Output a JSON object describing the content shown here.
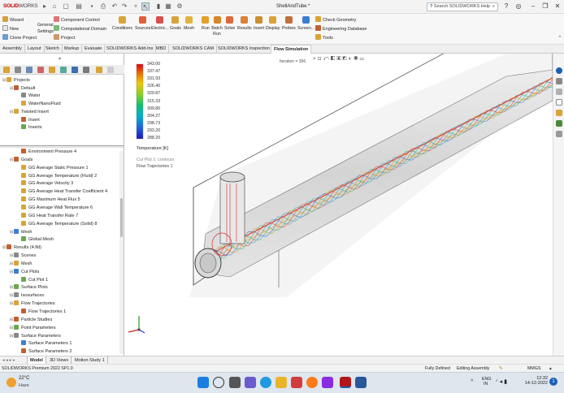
{
  "app": {
    "logo_brand": "SOLID",
    "logo_rest": "WORKS",
    "document_title": "ShellAndTube *",
    "search_placeholder": "Search SOLIDWORKS Help",
    "help_icon": "help-icon"
  },
  "ribbon": {
    "left_items": [
      "Wizard",
      "New",
      "Clone Project"
    ],
    "general_settings": "General Settings",
    "project_group": [
      "Component Control",
      "Computational Domain",
      "Project"
    ],
    "big_buttons": [
      "Conditions",
      "Sources",
      "Electric...",
      "Goals",
      "Mesh",
      "Run",
      "Batch Run",
      "Solve",
      "Results",
      "Insert",
      "Display",
      "Probes",
      "Screen..."
    ],
    "right_items": [
      "Check Geometry",
      "Engineering Database",
      "Tools"
    ]
  },
  "tabs": [
    "Assembly",
    "Layout",
    "Sketch",
    "Markup",
    "Evaluate",
    "SOLIDWORKS Add-Ins",
    "MBD",
    "SOLIDWORKS CAM",
    "SOLIDWORKS Inspection",
    "Flow Simulation"
  ],
  "active_tab": "Flow Simulation",
  "tree_top": [
    {
      "label": "Projects",
      "indent": 0
    },
    {
      "label": "Default",
      "indent": 1
    },
    {
      "label": "Water",
      "indent": 2
    },
    {
      "label": "WaterNanoFluid",
      "indent": 2
    },
    {
      "label": "Twisted Insert",
      "indent": 1
    },
    {
      "label": "Insert",
      "indent": 2
    },
    {
      "label": "Inserts",
      "indent": 2
    }
  ],
  "tree_bottom": [
    {
      "label": "Environment Pressure 4",
      "indent": 2
    },
    {
      "label": "Goals",
      "indent": 1
    },
    {
      "label": "GG Average Static Pressure 1",
      "indent": 2
    },
    {
      "label": "GG Average Temperature (Fluid) 2",
      "indent": 2
    },
    {
      "label": "GG Average Velocity 3",
      "indent": 2
    },
    {
      "label": "GG Average Heat Transfer Coefficient 4",
      "indent": 2
    },
    {
      "label": "GG Maximum Heat Flux 5",
      "indent": 2
    },
    {
      "label": "GG Average Wall Temperature 6",
      "indent": 2
    },
    {
      "label": "GG Heat Transfer Rate 7",
      "indent": 2
    },
    {
      "label": "GG Average Temperature (Solid) 8",
      "indent": 2
    },
    {
      "label": "Mesh",
      "indent": 1
    },
    {
      "label": "Global Mesh",
      "indent": 2
    },
    {
      "label": "Results (4.fld)",
      "indent": 0
    },
    {
      "label": "Scenes",
      "indent": 1
    },
    {
      "label": "Mesh",
      "indent": 1
    },
    {
      "label": "Cut Plots",
      "indent": 1
    },
    {
      "label": "Cut Plot 1",
      "indent": 2
    },
    {
      "label": "Surface Plots",
      "indent": 1
    },
    {
      "label": "Isosurfaces",
      "indent": 1
    },
    {
      "label": "Flow Trajectories",
      "indent": 1
    },
    {
      "label": "Flow Trajectories 1",
      "indent": 2
    },
    {
      "label": "Particle Studies",
      "indent": 1
    },
    {
      "label": "Point Parameters",
      "indent": 1
    },
    {
      "label": "Surface Parameters",
      "indent": 1
    },
    {
      "label": "Surface Parameters 1",
      "indent": 2
    },
    {
      "label": "Surface Parameters 2",
      "indent": 2
    }
  ],
  "legend": {
    "values": [
      "343.00",
      "337.47",
      "331.93",
      "326.40",
      "320.87",
      "315.33",
      "309.80",
      "304.27",
      "298.73",
      "293.20",
      "288.20"
    ],
    "title": "Temperature [K]",
    "caption1": "Cut Plot 1: contours",
    "caption2": "Flow Trajectories 1"
  },
  "viewport": {
    "iteration_label": "Iteration = 396"
  },
  "bottom_tabs": [
    "Model",
    "3D Views",
    "Motion Study 1"
  ],
  "status": {
    "version": "SOLIDWORKS Premium 2022 SP1.0",
    "state": "Fully Defined",
    "mode": "Editing Assembly",
    "units": "MMGS"
  },
  "taskbar": {
    "weather_temp": "22°C",
    "weather_desc": "Haze",
    "lang_top": "ENG",
    "lang_bottom": "IN",
    "time": "12:32",
    "date": "14-12-2022",
    "notif_count": "1"
  },
  "colors": {
    "accent": "#c00000",
    "flow_tab_bg": "#ffffff"
  }
}
